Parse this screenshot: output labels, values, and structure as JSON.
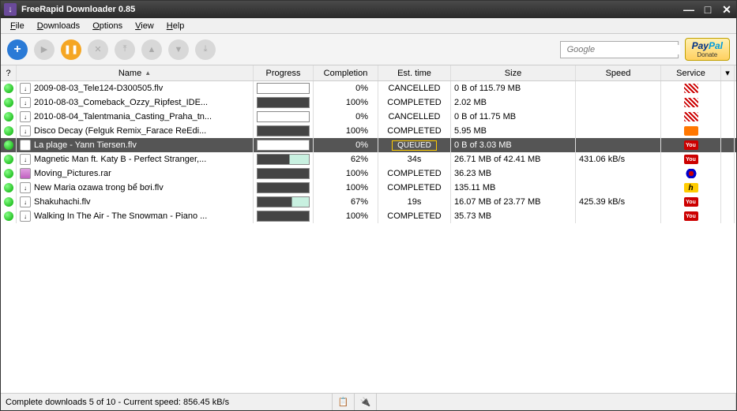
{
  "window": {
    "title": "FreeRapid Downloader 0.85"
  },
  "menu": {
    "file": "File",
    "downloads": "Downloads",
    "options": "Options",
    "view": "View",
    "help": "Help"
  },
  "search": {
    "placeholder": "Google"
  },
  "paypal": {
    "brand1": "Pay",
    "brand2": "Pal",
    "donate": "Donate"
  },
  "columns": {
    "q": "?",
    "name": "Name",
    "progress": "Progress",
    "completion": "Completion",
    "esttime": "Est. time",
    "size": "Size",
    "speed": "Speed",
    "service": "Service"
  },
  "rows": [
    {
      "name": "2009-08-03_Tele124-D300505.flv",
      "type": "flv",
      "progress": 0,
      "progressStyle": "pink",
      "completion": "0%",
      "esttime": "CANCELLED",
      "size": "0 B of 115.79 MB",
      "speed": "",
      "service": "stripes",
      "selected": false
    },
    {
      "name": "2010-08-03_Comeback_Ozzy_Ripfest_IDE...",
      "type": "flv",
      "progress": 100,
      "progressStyle": "dark",
      "completion": "100%",
      "esttime": "COMPLETED",
      "size": "2.02 MB",
      "speed": "",
      "service": "stripes",
      "selected": false
    },
    {
      "name": "2010-08-04_Talentmania_Casting_Praha_tn...",
      "type": "flv",
      "progress": 0,
      "progressStyle": "pink",
      "completion": "0%",
      "esttime": "CANCELLED",
      "size": "0 B of 11.75 MB",
      "speed": "",
      "service": "stripes",
      "selected": false
    },
    {
      "name": "Disco Decay (Felguk Remix_Farace ReEdi...",
      "type": "flv",
      "progress": 100,
      "progressStyle": "dark",
      "completion": "100%",
      "esttime": "COMPLETED",
      "size": "5.95 MB",
      "speed": "",
      "service": "sc",
      "selected": false
    },
    {
      "name": "La plage - Yann Tiersen.flv",
      "type": "flv",
      "progress": 0,
      "progressStyle": "cream",
      "completion": "0%",
      "esttime": "QUEUED",
      "size": "0 B of 3.03 MB",
      "speed": "",
      "service": "yt",
      "selected": true
    },
    {
      "name": "Magnetic Man ft. Katy B - Perfect Stranger,...",
      "type": "flv",
      "progress": 62,
      "progressStyle": "part",
      "completion": "62%",
      "esttime": "34s",
      "size": "26.71 MB of 42.41 MB",
      "speed": "431.06 kB/s",
      "service": "yt",
      "selected": false
    },
    {
      "name": "Moving_Pictures.rar",
      "type": "rar",
      "progress": 100,
      "progressStyle": "dark",
      "completion": "100%",
      "esttime": "COMPLETED",
      "size": "36.23 MB",
      "speed": "",
      "service": "swirl",
      "selected": false
    },
    {
      "name": "New Maria ozawa trong bể bơi.flv",
      "type": "flv",
      "progress": 100,
      "progressStyle": "dark",
      "completion": "100%",
      "esttime": "COMPLETED",
      "size": "135.11 MB",
      "speed": "",
      "service": "h",
      "selected": false
    },
    {
      "name": "Shakuhachi.flv",
      "type": "flv",
      "progress": 67,
      "progressStyle": "part",
      "completion": "67%",
      "esttime": "19s",
      "size": "16.07 MB of 23.77 MB",
      "speed": "425.39 kB/s",
      "service": "yt",
      "selected": false
    },
    {
      "name": "Walking In The Air - The Snowman - Piano ...",
      "type": "flv",
      "progress": 100,
      "progressStyle": "dark",
      "completion": "100%",
      "esttime": "COMPLETED",
      "size": "35.73 MB",
      "speed": "",
      "service": "yt",
      "selected": false
    }
  ],
  "status": {
    "text": "Complete downloads 5 of 10 - Current speed: 856.45 kB/s"
  }
}
